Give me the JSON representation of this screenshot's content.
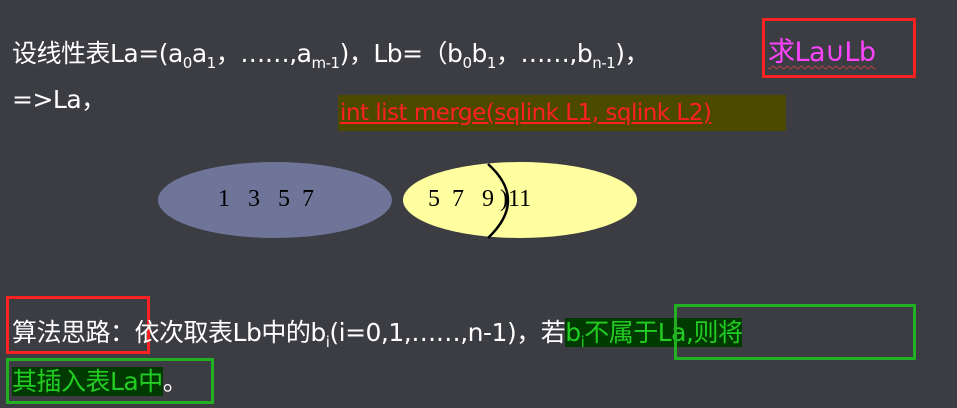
{
  "line1": {
    "prefix": "设线性表La=(a",
    "sub0": "0",
    "a": "a",
    "sub1": "1",
    "mid": "，……,a",
    "subm": "m-1",
    "mid2": ")，Lb=（b",
    "bsub0": "0",
    "b": "b",
    "bsub1": "1",
    "mid3": "，……,b",
    "subn": "n-1",
    "end": ")，",
    "highlight": "求La∪Lb"
  },
  "line2": "=>La，",
  "function_signature": "int list  merge(sqlink L1, sqlink L2)",
  "ellipse_left": {
    "values": "1   3   5  7",
    "color": "#6f7599"
  },
  "ellipse_right": {
    "values": "5  7   9 )11",
    "color": "#ffffa0"
  },
  "algorithm": {
    "label": "算法思路",
    "colon": "：",
    "text1": "依次取表Lb中的b",
    "sub_i": "i",
    "text2": "(i=0,1,……,n-1)，若",
    "hl_b": "b",
    "hl_sub": "i",
    "hl_text": "不属于La,则将",
    "line2_hl": "其插入表La中",
    "line2_end": "。"
  },
  "colors": {
    "background": "#3c3d42",
    "red_box": "#ff2020",
    "green_box": "#22b022",
    "magenta": "#ff44ff",
    "green_text": "#22cc22"
  }
}
